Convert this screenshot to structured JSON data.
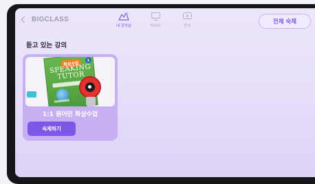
{
  "header": {
    "back_label": "BIGCLASS",
    "tabs": [
      {
        "label": "내 강의실",
        "icon": "classroom-icon",
        "active": true
      },
      {
        "label": "파이브",
        "icon": "monitor-icon",
        "active": false
      },
      {
        "label": "안내",
        "icon": "play-icon",
        "active": false
      }
    ],
    "all_homework_label": "전체 숙제"
  },
  "main": {
    "section_title": "듣고 있는 강의",
    "courses": [
      {
        "title": "1:1 원어민 화상수업",
        "cover": {
          "badge": "화상수업",
          "number": "1",
          "title_line1": "SPEAKING",
          "title_line2": "TUTOR"
        },
        "cta_label": "숙제하기"
      }
    ]
  },
  "colors": {
    "accent": "#7c57e8",
    "card_bg": "#c6b0f3",
    "screen_bg": "#ece6fb"
  }
}
